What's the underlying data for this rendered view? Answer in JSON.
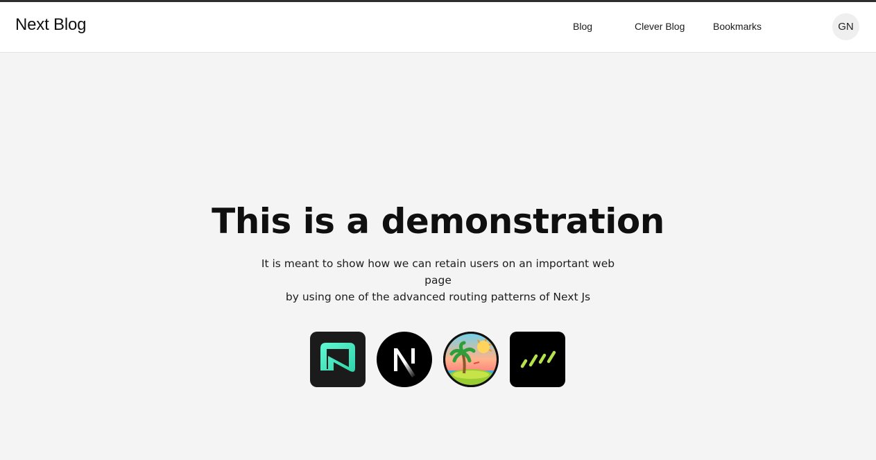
{
  "header": {
    "brand": "Next Blog",
    "nav": [
      {
        "label": "Blog"
      },
      {
        "label": "Clever Blog"
      },
      {
        "label": "Bookmarks"
      }
    ],
    "avatar_initials": "GN"
  },
  "hero": {
    "title": "This is a demonstration",
    "description_line1": "It is meant to show how we can retain users on an important web page",
    "description_line2": "by using one of the advanced routing patterns of Next Js"
  },
  "logos": [
    {
      "icon": "neon-logo-icon"
    },
    {
      "icon": "nextjs-logo-icon"
    },
    {
      "icon": "island-sun-logo-icon"
    },
    {
      "icon": "green-slashes-logo-icon"
    }
  ],
  "colors": {
    "background": "#f4f4f5",
    "header_bg": "#ffffff",
    "accent_teal": "#3fe3c0",
    "accent_lime": "#b6e34a"
  }
}
